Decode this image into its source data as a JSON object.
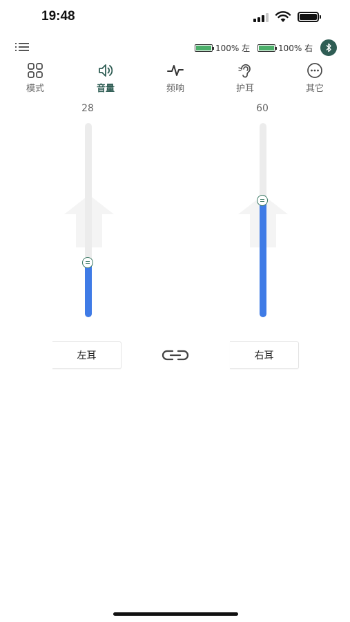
{
  "status_bar": {
    "time": "19:48"
  },
  "header": {
    "left_ear_battery": "100% 左",
    "right_ear_battery": "100% 右",
    "battery_color": "#4caf6a",
    "bluetooth_icon": "bluetooth-icon"
  },
  "nav": {
    "items": [
      {
        "label": "模式",
        "icon": "grid-icon"
      },
      {
        "label": "音量",
        "icon": "speaker-icon"
      },
      {
        "label": "频响",
        "icon": "waveform-icon"
      },
      {
        "label": "护耳",
        "icon": "ear-icon"
      },
      {
        "label": "其它",
        "icon": "more-icon"
      }
    ],
    "active_index": 1,
    "active_color": "#2f5d54"
  },
  "volume": {
    "left": {
      "value": "28",
      "level": 28,
      "max": 100
    },
    "right": {
      "value": "60",
      "level": 60,
      "max": 100
    },
    "fill_color": "#3f7be6",
    "left_button": "左耳",
    "right_button": "右耳"
  }
}
